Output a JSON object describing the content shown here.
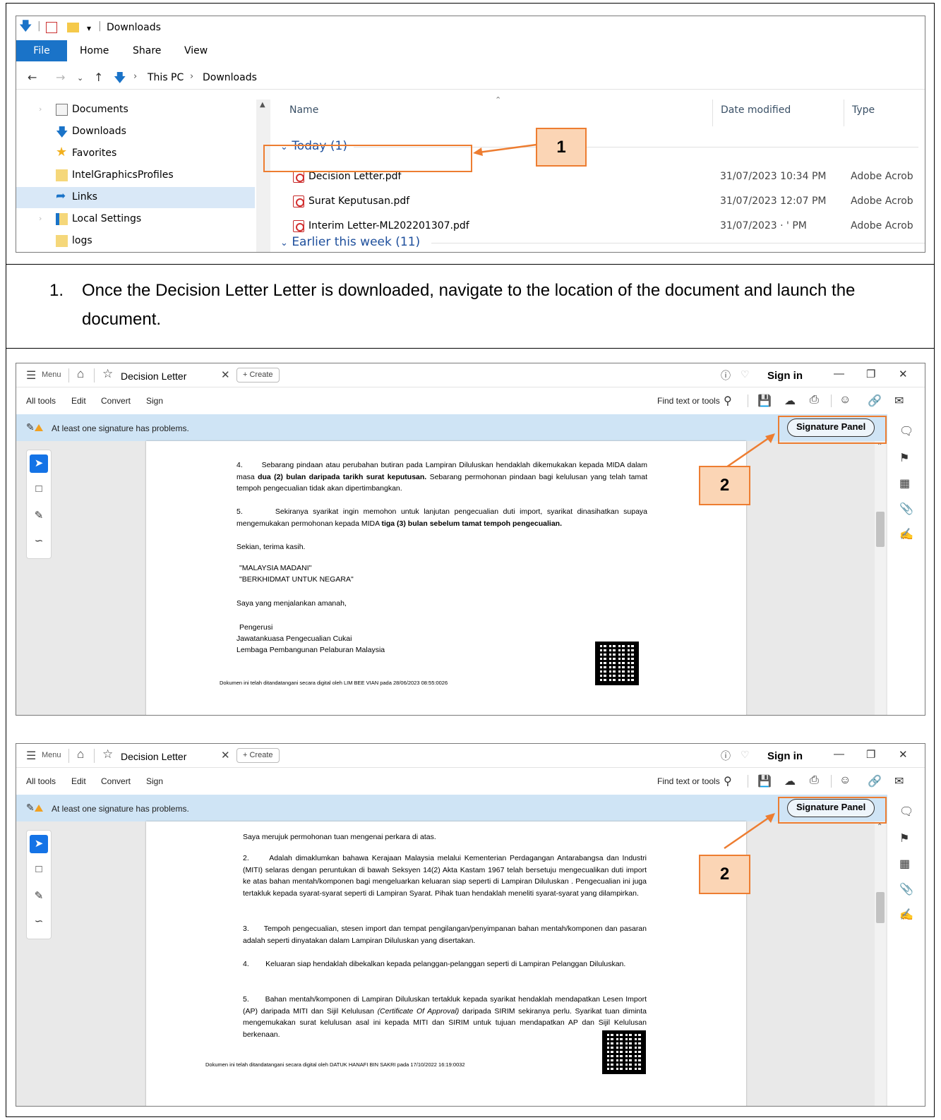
{
  "explorer": {
    "title": "Downloads",
    "menu": {
      "file": "File",
      "home": "Home",
      "share": "Share",
      "view": "View"
    },
    "breadcrumb": {
      "root": "This PC",
      "current": "Downloads"
    },
    "nav_items": [
      {
        "label": "Documents"
      },
      {
        "label": "Downloads"
      },
      {
        "label": "Favorites"
      },
      {
        "label": "IntelGraphicsProfiles"
      },
      {
        "label": "Links"
      },
      {
        "label": "Local Settings"
      },
      {
        "label": "logs"
      }
    ],
    "columns": {
      "name": "Name",
      "date": "Date modified",
      "type": "Type"
    },
    "groups": {
      "today": "Today (1)",
      "earlier": "Earlier this week (11)"
    },
    "files": [
      {
        "name": "Decision Letter.pdf",
        "date": "31/07/2023 10:34 PM",
        "type": "Adobe Acrob"
      },
      {
        "name": "Surat Keputusan.pdf",
        "date": "31/07/2023 12:07 PM",
        "type": "Adobe Acrob"
      },
      {
        "name": "Interim Letter-ML202201307.pdf",
        "date": "31/07/2023 ·     ' PM",
        "type": "Adobe Acrob"
      }
    ]
  },
  "callouts": {
    "one": "1",
    "two": "2"
  },
  "instruction": {
    "number": "1.",
    "text": "Once the Decision Letter Letter is downloaded, navigate to the location of the document and launch the document."
  },
  "acrobat": {
    "menu": "Menu",
    "doc_title": "Decision Letter",
    "create": "+ Create",
    "sign_in": "Sign in",
    "tools": {
      "all": "All tools",
      "edit": "Edit",
      "convert": "Convert",
      "sign": "Sign"
    },
    "find": "Find text or tools",
    "banner_msg": "At least one signature has problems.",
    "signature_panel": "Signature Panel"
  },
  "doc1": {
    "p4": "4.       Sebarang pindaan atau perubahan butiran pada Lampiran Diluluskan hendaklah dikemukakan kepada MIDA dalam masa",
    "p4_bold": "dua (2) bulan daripada tarikh surat keputusan.",
    "p4_rest": "Sebarang permohonan pindaan bagi kelulusan yang telah tamat tempoh pengecualian tidak akan dipertimbangkan.",
    "p5": "5.       Sekiranya syarikat ingin memohon untuk lanjutan pengecualian duti import, syarikat dinasihatkan supaya mengemukakan permohonan kepada MIDA",
    "p5_bold": "tiga (3) bulan sebelum tamat tempoh pengecualian.",
    "thanks": "Sekian, terima kasih.",
    "slogan1": "\"MALAYSIA MADANI\"",
    "slogan2": "\"BERKHIDMAT UNTUK NEGARA\"",
    "amanah": "Saya yang menjalankan amanah,",
    "sign1": "Pengerusi",
    "sign2": "Jawatankuasa Pengecualian Cukai",
    "sign3": "Lembaga Pembangunan Pelaburan Malaysia",
    "footer": "Dokumen ini telah ditandatangani secara digital oleh LIM BEE VIAN pada 28/06/2023 08:55:0026"
  },
  "doc2": {
    "p1": "Saya merujuk permohonan tuan mengenai perkara di atas.",
    "p2": "2.      Adalah dimaklumkan bahawa Kerajaan Malaysia melalui Kementerian Perdagangan Antarabangsa dan Industri (MITI) selaras dengan peruntukan di bawah Seksyen 14(2) Akta Kastam 1967 telah bersetuju mengecualikan duti import ke atas bahan mentah/komponen bagi mengeluarkan keluaran siap seperti di Lampiran Diluluskan . Pengecualian ini juga tertakluk kepada syarat-syarat seperti di Lampiran Syarat. Pihak tuan hendaklah meneliti syarat-syarat yang dilampirkan.",
    "p3": "3.      Tempoh pengecualian, stesen import dan tempat pengilangan/penyimpanan bahan mentah/komponen dan pasaran adalah seperti dinyatakan dalam Lampiran Diluluskan yang disertakan.",
    "p4": "4.        Keluaran siap hendaklah dibekalkan kepada pelanggan-pelanggan seperti di Lampiran Pelanggan Diluluskan.",
    "p5a": "5.      Bahan mentah/komponen di Lampiran Diluluskan tertakluk kepada syarikat hendaklah mendapatkan Lesen Import (AP) daripada MITI dan Sijil Kelulusan",
    "p5_italic": "(Certificate Of Approval)",
    "p5b": "daripada SIRIM sekiranya perlu. Syarikat tuan diminta mengemukakan surat kelulusan asal ini kepada MITI dan SIRIM untuk tujuan mendapatkan AP dan Sijil Kelulusan berkenaan.",
    "footer": "Dokumen ini telah ditandatangani secara digital oleh DATUK HANAFI BIN SAKRI pada 17/10/2022 16:19:0032"
  }
}
